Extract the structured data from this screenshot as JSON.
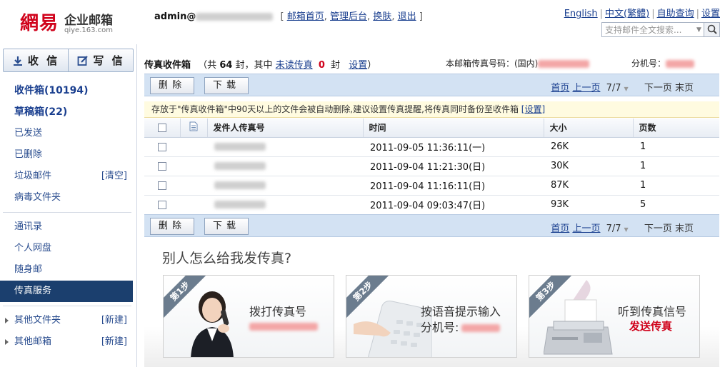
{
  "header": {
    "brand": "網易",
    "product": "企业邮箱",
    "domain": "qiye.163.com",
    "user": "admin@",
    "user_links": [
      {
        "label": "邮箱首页"
      },
      {
        "label": "管理后台"
      },
      {
        "label": "换肤"
      },
      {
        "label": "退出"
      }
    ],
    "top_links": [
      {
        "label": "English"
      },
      {
        "label": "中文(繁體)"
      },
      {
        "label": "自助查询"
      },
      {
        "label": "设置"
      }
    ],
    "search_placeholder": "支持邮件全文搜索..."
  },
  "sidebar": {
    "receive_label": "收 信",
    "write_label": "写 信",
    "folders": [
      {
        "label": "收件箱(10194)"
      },
      {
        "label": "草稿箱(22)"
      },
      {
        "label": "已发送"
      },
      {
        "label": "已删除"
      },
      {
        "label": "垃圾邮件",
        "extra": "[清空]"
      },
      {
        "label": "病毒文件夹"
      }
    ],
    "services": [
      {
        "label": "通讯录"
      },
      {
        "label": "个人网盘"
      },
      {
        "label": "随身邮"
      },
      {
        "label": "传真服务"
      }
    ],
    "others": [
      {
        "label": "其他文件夹",
        "extra": "[新建]"
      },
      {
        "label": "其他邮箱",
        "extra": "[新建]"
      }
    ]
  },
  "main": {
    "title": "传真收件箱",
    "count_prefix": "（共",
    "count": "64",
    "count_mid": "封，其中",
    "unread_link": "未读传真",
    "unread_count": "0",
    "count_suffix": "封",
    "settings_link": "设置",
    "count_close": "）",
    "fax_number_label": "本邮箱传真号码：(国内)",
    "extension_label": "分机号：",
    "toolbar": {
      "delete_label": "删除",
      "download_label": "下载",
      "first_page": "首页",
      "prev_page": "上一页",
      "page_indicator": "7/7",
      "next_page": "下一页",
      "last_page": "末页"
    },
    "notice": "存放于\"传真收件箱\"中90天以上的文件会被自动删除,建议设置传真提醒,将传真同时备份至收件箱",
    "notice_link": "[设置]",
    "columns": [
      "发件人传真号",
      "时间",
      "大小",
      "页数"
    ],
    "rows": [
      {
        "time": "2011-09-05 11:36:11(一)",
        "size": "26K",
        "pages": "1"
      },
      {
        "time": "2011-09-04 11:21:30(日)",
        "size": "30K",
        "pages": "1"
      },
      {
        "time": "2011-09-04 11:16:11(日)",
        "size": "87K",
        "pages": "1"
      },
      {
        "time": "2011-09-04 09:03:47(日)",
        "size": "93K",
        "pages": "5"
      }
    ]
  },
  "promo": {
    "title": "别人怎么给我发传真?",
    "steps": [
      {
        "badge": "第1步",
        "text": "拨打传真号"
      },
      {
        "badge": "第2步",
        "text": "按语音提示输入",
        "text2": "分机号:"
      },
      {
        "badge": "第3步",
        "text": "听到传真信号",
        "text2": "发送传真"
      }
    ]
  }
}
